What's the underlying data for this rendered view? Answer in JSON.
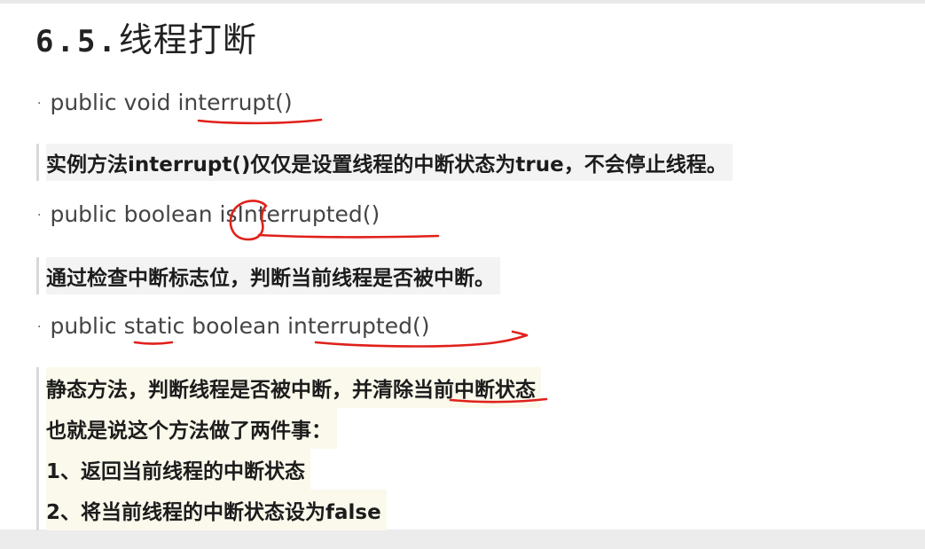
{
  "heading": {
    "number": "6.5.",
    "title": "线程打断"
  },
  "methods": [
    {
      "signature": "public void interrupt()",
      "description_lines": [
        "实例方法interrupt()仅仅是设置线程的中断状态为true，不会停止线程。"
      ]
    },
    {
      "signature": "public boolean isInterrupted()",
      "description_lines": [
        "通过检查中断标志位，判断当前线程是否被中断。"
      ]
    },
    {
      "signature": "public static boolean interrupted()",
      "description_lines": [
        "静态方法，判断线程是否被中断，并清除当前中断状态",
        "也就是说这个方法做了两件事：",
        "1、返回当前线程的中断状态",
        "2、将当前线程的中断状态设为false"
      ]
    }
  ],
  "annotation_color": "#e0201a"
}
